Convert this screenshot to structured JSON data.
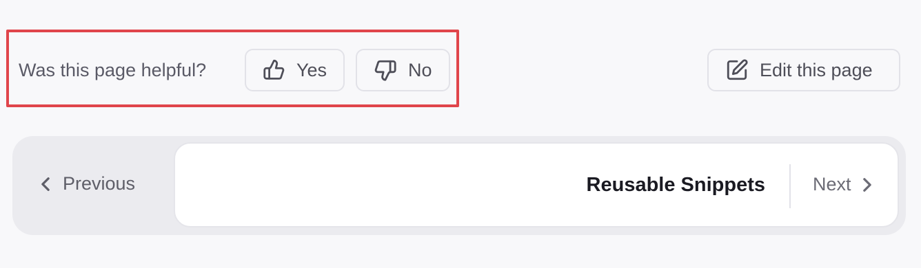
{
  "feedback": {
    "question": "Was this page helpful?",
    "yes_label": "Yes",
    "no_label": "No"
  },
  "edit": {
    "label": "Edit this page"
  },
  "pagination": {
    "previous_label": "Previous",
    "next_title": "Reusable Snippets",
    "next_label": "Next"
  },
  "colors": {
    "page_background": "#f8f8fa",
    "highlight_border": "#e0454b",
    "nav_background": "#ebebef",
    "card_background": "#ffffff",
    "text_primary": "#1a1a22",
    "text_muted": "#5a5a66"
  },
  "icons": {
    "yes": "thumbs-up-icon",
    "no": "thumbs-down-icon",
    "edit": "edit-pencil-icon",
    "previous": "chevron-left-icon",
    "next": "chevron-right-icon"
  }
}
